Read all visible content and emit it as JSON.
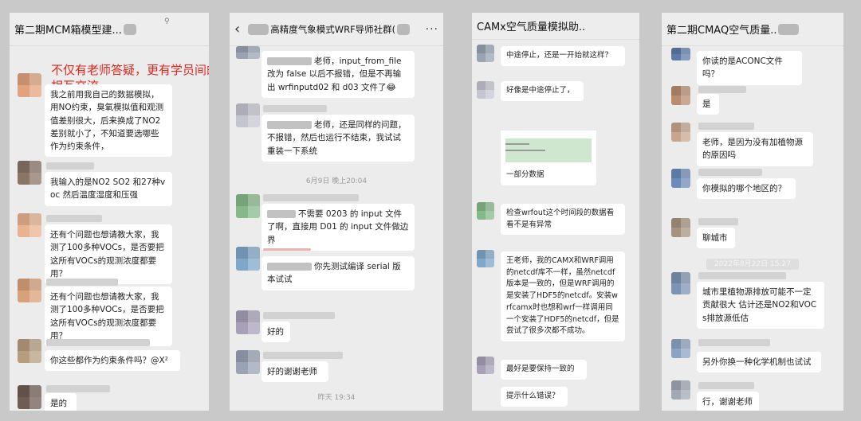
{
  "panel1": {
    "title": "第二期MCM箱模型建...",
    "pin": "⚲",
    "overlay_caption": "不仅有老师答疑，更有学员间的相互交流",
    "messages": [
      "我之前用我自己的数据模拟，用NO约束，臭氧模拟值和观测值差别很大，后来换成了NO2差别就小了，不知道要选哪些作为约束条件，",
      "我输入的是NO2  SO2 和27种voc  然后温度湿度和压强",
      "还有个问题也想请教大家，我测了100多种VOCs，是否要把这所有VOCs的观测浓度都要用？",
      "还有个问题也想请教大家，我测了100多种VOCs，是否要把这所有VOCs的观测浓度都要用？",
      "你这些都作为约束条件吗？@X²",
      "是的"
    ],
    "avatar_colors": [
      "#e2a37c",
      "#8a7466",
      "#e9b38f",
      "#d9a17a",
      "#b79d7f",
      "#6f5c52"
    ]
  },
  "panel2": {
    "back": "‹",
    "title": "高精度气象模式WRF导师社群(",
    "more": "···",
    "messages": [
      "老师，input_from_file 改为 false 以后不报错，但是不再输出 wrfinputd02 和 d03 文件了😂",
      "老师，还是同样的问题，不报错，然后也运行不结束，我试试重装一下系统",
      "不需要 0203 的 input 文件了啊，直接用 D01 的 input 文件做边界",
      "你先测试编译 serial 版本试试",
      "好的",
      "好的谢谢老师"
    ],
    "timestamps": [
      "6月9日 晚上20:04",
      "昨天 19:34"
    ],
    "avatar_colors": [
      "#9aa3b4",
      "#c5c5d0",
      "#86b98a",
      "#7fa7c9",
      "#a7a0b8"
    ]
  },
  "panel3": {
    "title": "CAMx空气质量模拟助..",
    "messages": [
      "中途停止，还是一开始就这样？",
      "好像是中途停止了，",
      "一部分数据",
      "检查wrfout这个时间段的数据看看不是有异常",
      "王老师，我的CAMX和WRF调用的netcdf库不一样，虽然netcdf版本是一致的，但是WRF调用的是安装了HDF5的netcdf。安装wrfcamx时也想和wrf一样调用同一个安装了HDF5的netcdf，但是尝试了很多次都不成功。",
      "最好是要保持一致的",
      "提示什么错误？"
    ]
  },
  "panel4": {
    "title": "第二期CMAQ空气质量..",
    "messages": [
      "你读的是ACONC文件吗？",
      "是",
      "老师，是因为没有加植物源的原因吗",
      "你模拟的哪个地区的？",
      "聊城市",
      "城市里植物源排放可能不一定贡献很大  估计还是NO2和VOCs排放源低估",
      "另外你换一种化学机制也试试",
      "行，谢谢老师"
    ],
    "timestamp": "2022年8月22日 15:27",
    "avatar_colors": [
      "#5f7aa8",
      "#b98c6f",
      "#c7a58f",
      "#6c8bb8",
      "#a79480",
      "#7d93b3",
      "#8da3c4",
      "#a1a9b6"
    ]
  }
}
